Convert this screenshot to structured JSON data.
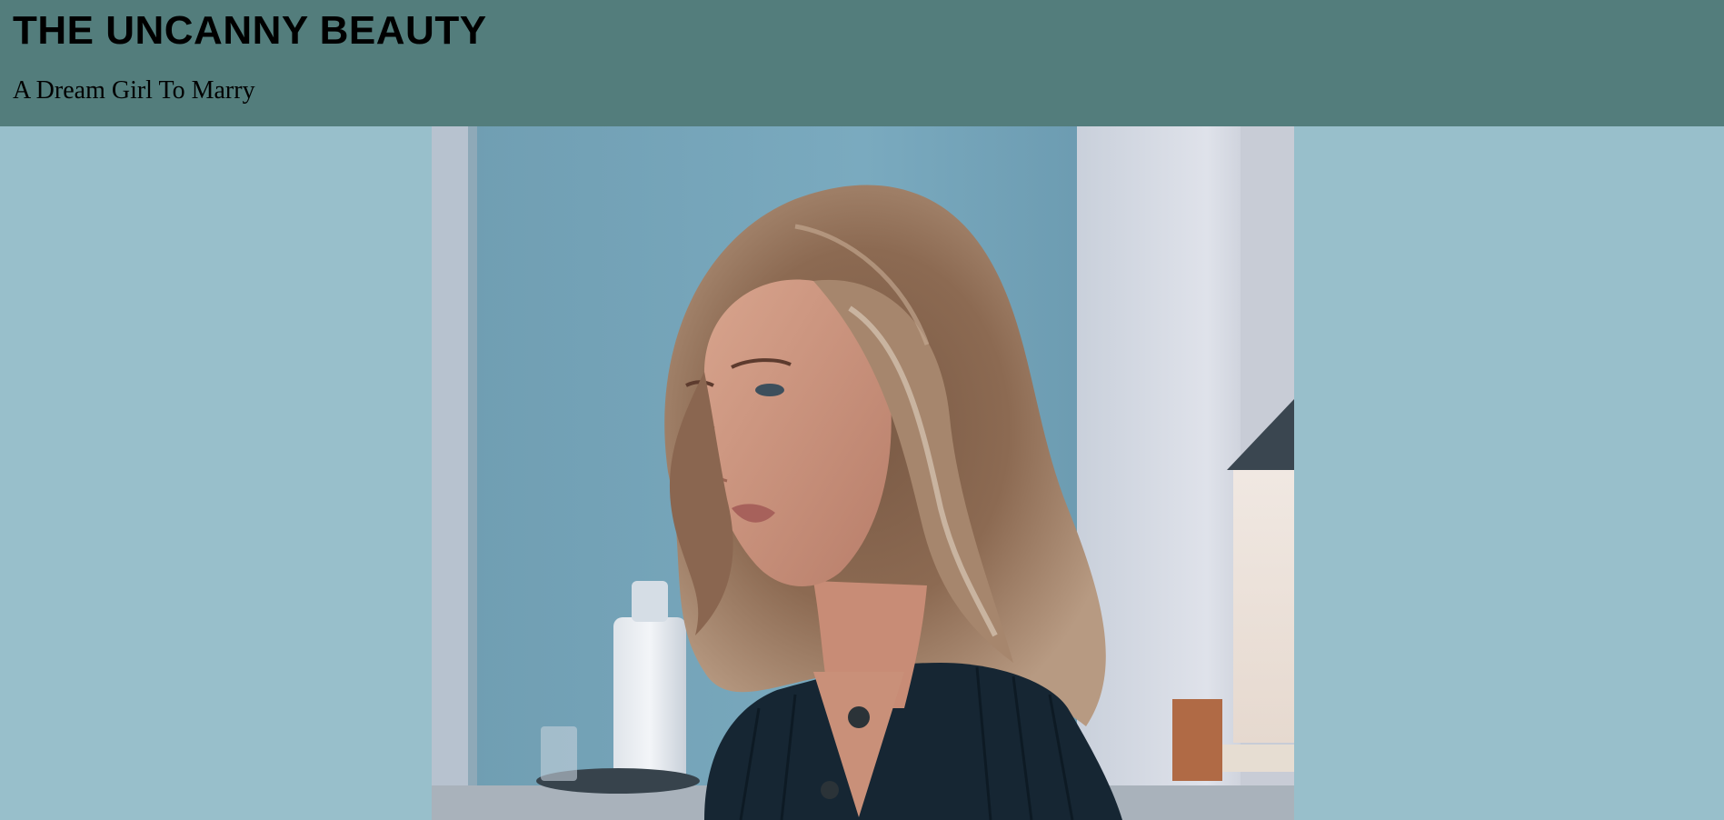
{
  "header": {
    "title": "THE UNCANNY BEAUTY",
    "subtitle": "A Dream Girl To Marry"
  },
  "colors": {
    "header_bg": "#537d7c",
    "page_bg": "#98bfcb"
  },
  "photo": {
    "subject": "portrait-photo"
  }
}
